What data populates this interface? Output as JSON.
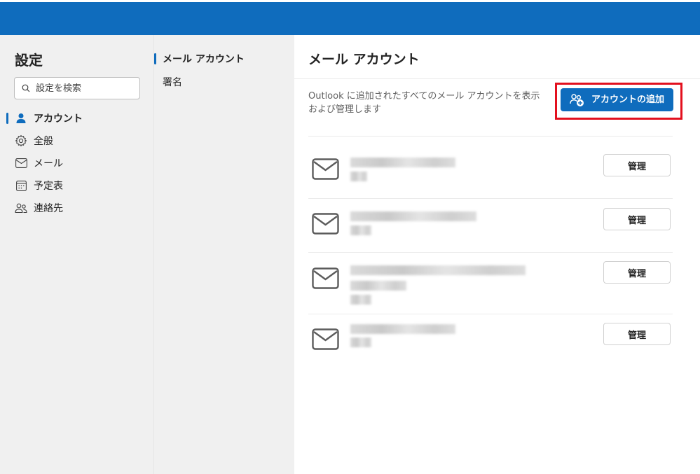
{
  "app": {
    "header_accent": "#0f6cbd",
    "highlight_color": "#e3101e"
  },
  "sidebar": {
    "title": "設定",
    "search_placeholder": "設定を検索",
    "items": [
      {
        "label": "アカウント",
        "icon": "person-icon",
        "active": true
      },
      {
        "label": "全般",
        "icon": "gear-icon",
        "active": false
      },
      {
        "label": "メール",
        "icon": "mail-icon",
        "active": false
      },
      {
        "label": "予定表",
        "icon": "calendar-icon",
        "active": false
      },
      {
        "label": "連絡先",
        "icon": "people-icon",
        "active": false
      }
    ]
  },
  "subnav": {
    "items": [
      {
        "label": "メール アカウント",
        "active": true
      },
      {
        "label": "署名",
        "active": false
      }
    ]
  },
  "main": {
    "title": "メール アカウント",
    "description": "Outlook に追加されたすべてのメール アカウントを表示および管理します",
    "add_button_label": "アカウントの追加",
    "accounts": [
      {
        "manage_label": "管理"
      },
      {
        "manage_label": "管理"
      },
      {
        "manage_label": "管理"
      },
      {
        "manage_label": "管理"
      }
    ]
  }
}
